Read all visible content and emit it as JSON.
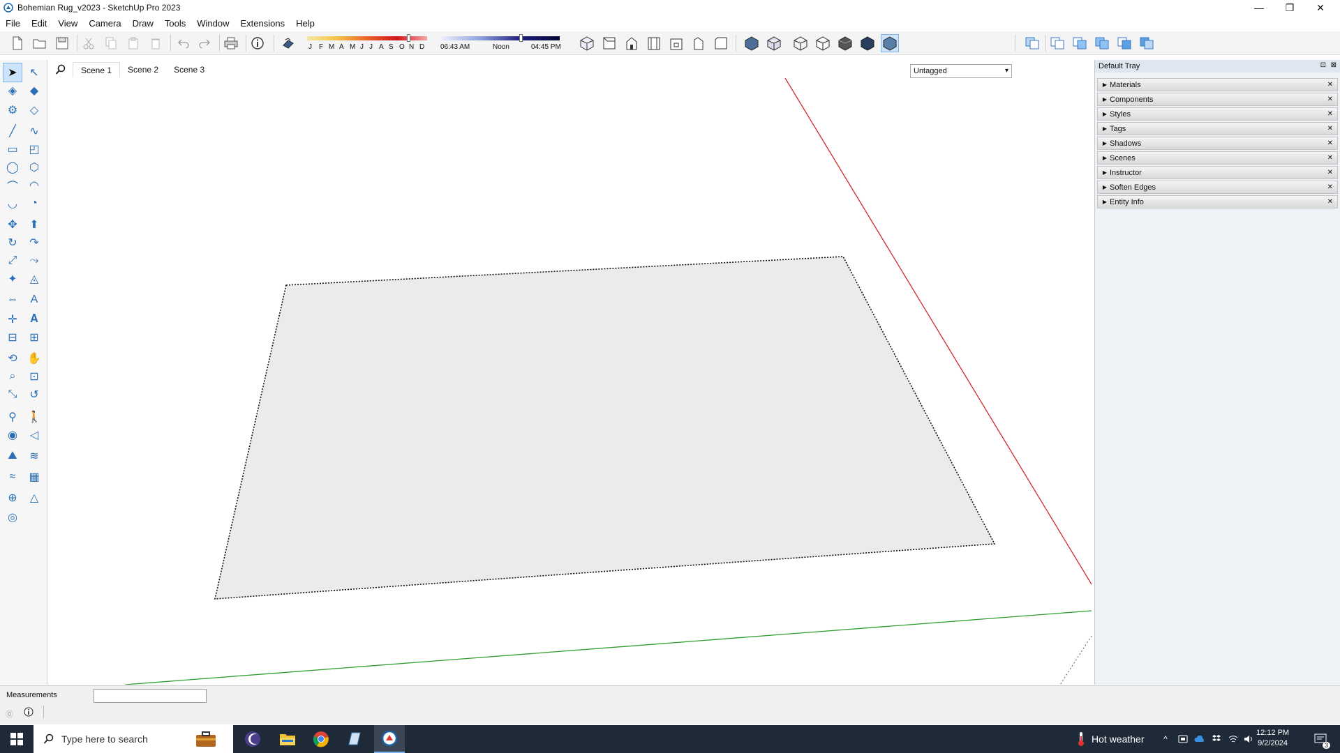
{
  "window": {
    "title": "Bohemian Rug_v2023 - SketchUp Pro 2023",
    "minimize": "—",
    "restore": "❐",
    "close": "✕"
  },
  "menu": [
    "File",
    "Edit",
    "View",
    "Camera",
    "Draw",
    "Tools",
    "Window",
    "Extensions",
    "Help"
  ],
  "shadows": {
    "months": [
      "J",
      "F",
      "M",
      "A",
      "M",
      "J",
      "J",
      "A",
      "S",
      "O",
      "N",
      "D"
    ],
    "time_start": "06:43 AM",
    "time_mid": "Noon",
    "time_end": "04:45 PM"
  },
  "tag_dropdown": {
    "selected": "Untagged"
  },
  "scenes": {
    "tabs": [
      "Scene 1",
      "Scene 2",
      "Scene 3"
    ],
    "active": "Scene 1"
  },
  "tray": {
    "title": "Default Tray",
    "panels": [
      "Materials",
      "Components",
      "Styles",
      "Tags",
      "Shadows",
      "Scenes",
      "Instructor",
      "Soften Edges",
      "Entity Info"
    ]
  },
  "status": {
    "measurements_label": "Measurements",
    "measurements_value": ""
  },
  "taskbar": {
    "search_placeholder": "Type here to search",
    "weather": "Hot weather",
    "time": "12:12 PM",
    "date": "9/2/2024",
    "notification_count": "3"
  },
  "colors": {
    "red_axis": "#cc2a2a",
    "green_axis": "#2e9e2e",
    "face_fill": "#ebebeb",
    "taskbar_bg": "#1f2a38"
  },
  "icons": {
    "left_tools": [
      "select-icon",
      "lasso-select-icon",
      "paint-bucket-icon",
      "eraser-icon",
      "tag-tool-icon",
      "erase-all-icon",
      "line-icon",
      "freehand-icon",
      "rectangle-icon",
      "rotated-rectangle-icon",
      "circle-icon",
      "polygon-icon",
      "arc-icon",
      "two-point-arc-icon",
      "three-point-arc-icon",
      "pie-icon",
      "move-icon",
      "push-pull-icon",
      "rotate-icon",
      "follow-me-icon",
      "scale-icon",
      "offset-icon",
      "tape-measure-icon",
      "protractor-icon",
      "dimension-icon",
      "text-icon",
      "axes-icon",
      "3d-text-icon",
      "section-plane-icon",
      "section-display-icon",
      "orbit-icon",
      "pan-icon",
      "zoom-icon",
      "zoom-window-icon",
      "zoom-extents-icon",
      "previous-view-icon",
      "position-camera-icon",
      "walk-icon",
      "look-around-icon",
      "position-camera-2-icon",
      "sandbox-from-contours-icon",
      "sandbox-from-scratch-icon",
      "smoove-icon",
      "stamp-icon",
      "drape-icon",
      "flip-edge-icon",
      "add-detail-icon"
    ]
  }
}
